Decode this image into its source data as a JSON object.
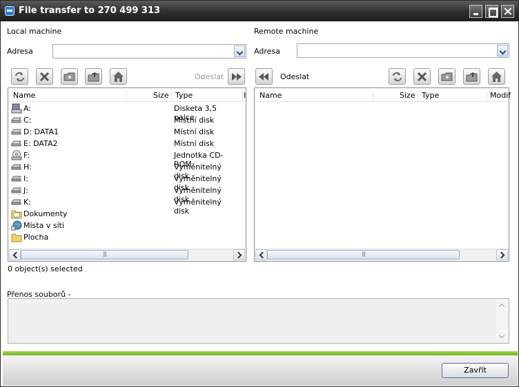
{
  "window": {
    "title": "File transfer to 270 499 313"
  },
  "local": {
    "heading": "Local machine",
    "address_label": "Adresa",
    "address_value": "",
    "send_label": "Odeslat",
    "columns": [
      "Name",
      "Size",
      "Type",
      "I"
    ],
    "rows": [
      {
        "name": "A:",
        "type": "Disketa 3,5 palce",
        "icon": "floppy-drive-icon"
      },
      {
        "name": "C:",
        "type": "Místní disk",
        "icon": "hard-disk-icon"
      },
      {
        "name": "D:  DATA1",
        "type": "Místní disk",
        "icon": "hard-disk-icon"
      },
      {
        "name": "E:  DATA2",
        "type": "Místní disk",
        "icon": "hard-disk-icon"
      },
      {
        "name": "F:",
        "type": "Jednotka CD-ROM",
        "icon": "cd-drive-icon"
      },
      {
        "name": "H:",
        "type": "Vyměnitelný disk",
        "icon": "removable-disk-icon"
      },
      {
        "name": "I:",
        "type": "Vyměnitelný disk",
        "icon": "removable-disk-icon"
      },
      {
        "name": "J:",
        "type": "Vyměnitelný disk",
        "icon": "removable-disk-icon"
      },
      {
        "name": "K:",
        "type": "Vyměnitelný disk",
        "icon": "removable-disk-icon"
      },
      {
        "name": "Dokumenty",
        "type": "",
        "icon": "documents-folder-icon"
      },
      {
        "name": "Místa v síti",
        "type": "",
        "icon": "network-places-icon"
      },
      {
        "name": "Plocha",
        "type": "",
        "icon": "desktop-folder-icon"
      }
    ],
    "status": "0 object(s) selected"
  },
  "remote": {
    "heading": "Remote machine",
    "address_label": "Adresa",
    "address_value": "",
    "send_label": "Odeslat",
    "columns": [
      "Name",
      "Size",
      "Type",
      "Modif"
    ]
  },
  "transfer": {
    "label": "Přenos souborů -"
  },
  "footer": {
    "close_label": "Zavřít"
  },
  "colors": {
    "accent_green": "#7cc22b",
    "titlebar": "#2e2e2e",
    "button_border": "#4d6f9c"
  }
}
